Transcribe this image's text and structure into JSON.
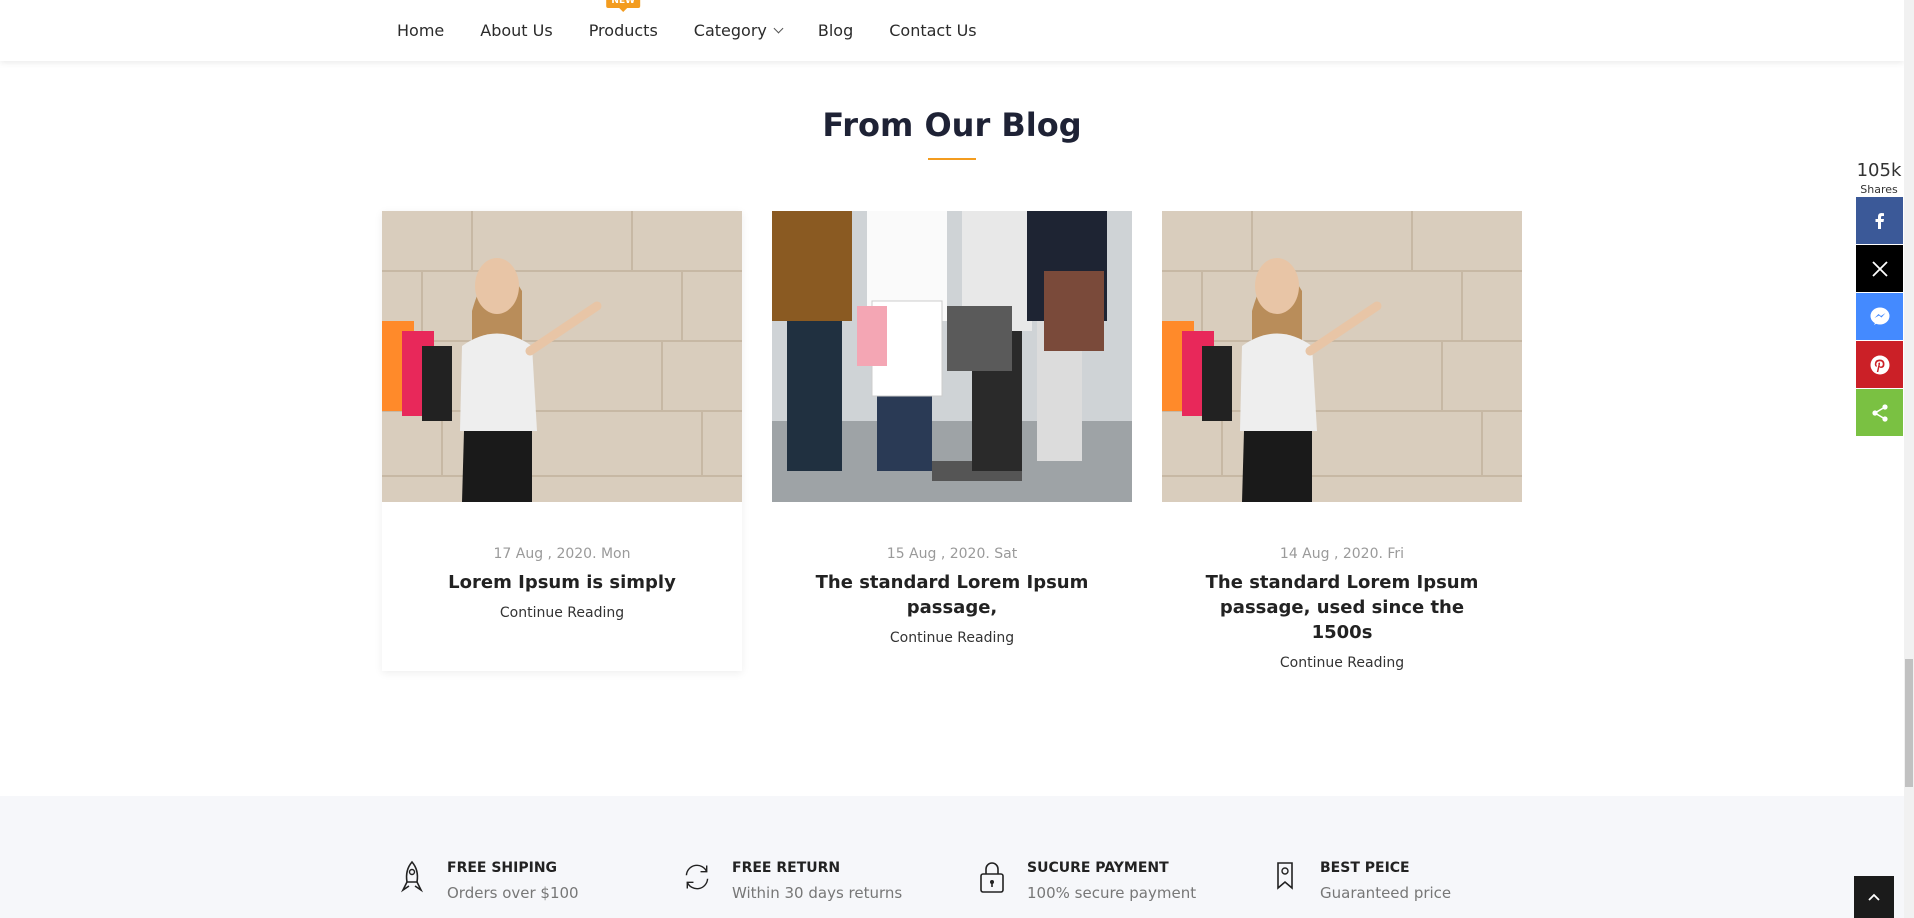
{
  "nav": {
    "items": [
      {
        "label": "Home"
      },
      {
        "label": "About Us"
      },
      {
        "label": "Products",
        "badge": "NEW"
      },
      {
        "label": "Category"
      },
      {
        "label": "Blog"
      },
      {
        "label": "Contact Us"
      }
    ]
  },
  "blog": {
    "heading": "From Our Blog",
    "posts": [
      {
        "date": "17 Aug , 2020. Mon",
        "title": "Lorem Ipsum is simply",
        "link": "Continue Reading",
        "image": "woman-shopping-bags-photo"
      },
      {
        "date": "15 Aug , 2020. Sat",
        "title": "The standard Lorem Ipsum passage,",
        "link": "Continue Reading",
        "image": "group-shopping-bags-photo"
      },
      {
        "date": "14 Aug , 2020. Fri",
        "title": "The standard Lorem Ipsum passage, used since the 1500s",
        "link": "Continue Reading",
        "image": "woman-shopping-bags-photo"
      }
    ]
  },
  "features": [
    {
      "title": "FREE SHIPING",
      "subtitle": "Orders over $100",
      "icon": "rocket-icon"
    },
    {
      "title": "FREE RETURN",
      "subtitle": "Within 30 days returns",
      "icon": "refresh-icon"
    },
    {
      "title": "SUCURE PAYMENT",
      "subtitle": "100% secure payment",
      "icon": "lock-icon"
    },
    {
      "title": "BEST PEICE",
      "subtitle": "Guaranteed price",
      "icon": "tag-icon"
    }
  ],
  "share": {
    "count": "105k",
    "label": "Shares",
    "buttons": [
      {
        "network": "facebook",
        "color": "#3b5998"
      },
      {
        "network": "x",
        "color": "#000000"
      },
      {
        "network": "messenger",
        "color": "#448aff"
      },
      {
        "network": "pinterest",
        "color": "#cb2027"
      },
      {
        "network": "share",
        "color": "#7ac142"
      }
    ]
  },
  "colors": {
    "accent": "#f39c1f",
    "heading": "#1e2235"
  }
}
